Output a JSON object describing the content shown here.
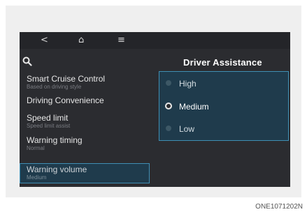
{
  "topbar": {
    "back_icon": "chevron-left-icon",
    "back_glyph": "<",
    "home_icon": "home-icon",
    "home_glyph": "⌂",
    "menu_icon": "menu-icon",
    "menu_glyph": "≡"
  },
  "search": {
    "icon": "search-icon",
    "glyph": "🔍"
  },
  "page": {
    "title": "Driver Assistance"
  },
  "menu": {
    "items": [
      {
        "label": "Smart Cruise Control",
        "sub": "Based on driving style"
      },
      {
        "label": "Driving Convenience",
        "sub": ""
      },
      {
        "label": "Speed limit",
        "sub": "Speed limit assist"
      },
      {
        "label": "Warning timing",
        "sub": "Normal"
      },
      {
        "label": "Warning volume",
        "sub": "Medium"
      }
    ]
  },
  "options": {
    "items": [
      {
        "label": "High"
      },
      {
        "label": "Medium"
      },
      {
        "label": "Low"
      }
    ],
    "selected": "Medium"
  },
  "caption": "ONE1071202N",
  "colors": {
    "screen_bg": "#2b2c30",
    "highlight_border": "#3f8fb4",
    "highlight_bg": "#1f3b4c"
  }
}
